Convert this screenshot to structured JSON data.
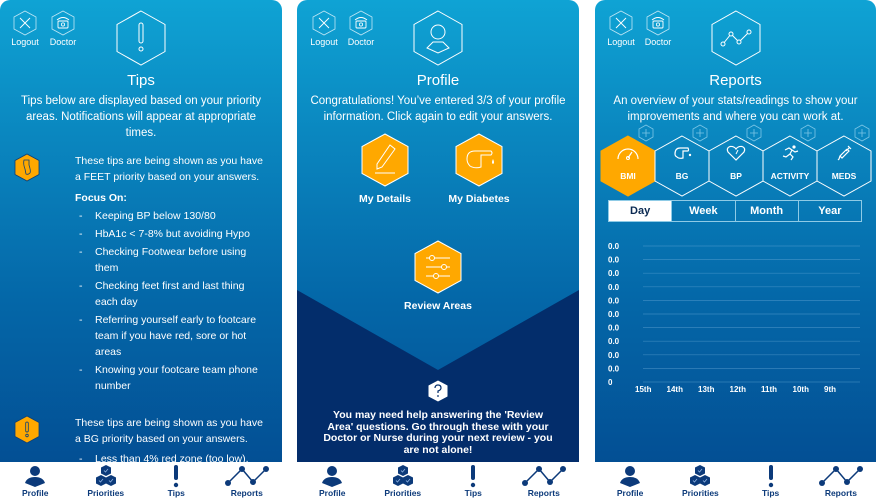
{
  "colors": {
    "accent": "#ffa800",
    "nav": "#0c3a7a",
    "panel_top": "#0fa3d4",
    "panel_bottom": "#034f94",
    "dark": "#032d6b"
  },
  "top_buttons": {
    "logout": "Logout",
    "doctor": "Doctor"
  },
  "nav": [
    {
      "label": "Profile",
      "icon": "person-icon"
    },
    {
      "label": "Priorities",
      "icon": "priorities-hex-icon"
    },
    {
      "label": "Tips",
      "icon": "exclamation-icon"
    },
    {
      "label": "Reports",
      "icon": "line-graph-icon"
    }
  ],
  "tips_screen": {
    "title": "Tips",
    "description": "Tips below are displayed based on your priority areas. Notifications will appear at appropriate times.",
    "blocks": [
      {
        "icon": "foot-icon",
        "intro": "These tips are being shown as you have a FEET priority based on your answers.",
        "focus_label": "Focus On:",
        "items": [
          "Keeping BP below 130/80",
          "HbA1c < 7-8% but avoiding Hypo",
          "Checking Footwear before using them",
          "Checking feet first and last thing each day",
          "Referring yourself early to footcare team if you have red, sore or hot areas",
          "Knowing your footcare team phone number"
        ]
      },
      {
        "icon": "exclamation-icon",
        "intro": "These tips are being shown as you have a BG priority based on your answers.",
        "items": [
          "Less than 4% red zone (too low),"
        ]
      }
    ]
  },
  "profile_screen": {
    "title": "Profile",
    "description": "Congratulations! You’ve entered 3/3 of your profile information. Click again to edit your answers.",
    "actions": [
      {
        "label": "My Details",
        "icon": "pencil-icon"
      },
      {
        "label": "My Diabetes",
        "icon": "finger-prick-icon"
      },
      {
        "label": "Review Areas",
        "icon": "sliders-icon"
      }
    ],
    "help_note": "You may need help answering the 'Review Area' questions. Go through these with your Doctor or Nurse during your next review - you are not alone!"
  },
  "reports_screen": {
    "title": "Reports",
    "description": "An overview of your stats/readings to show your improvements and where you can work at.",
    "metrics": [
      {
        "label": "BMI",
        "icon": "gauge-icon",
        "active": true
      },
      {
        "label": "BG",
        "icon": "finger-prick-icon",
        "active": false
      },
      {
        "label": "BP",
        "icon": "heart-icon",
        "active": false
      },
      {
        "label": "ACTIVITY",
        "icon": "runner-icon",
        "active": false
      },
      {
        "label": "MEDS",
        "icon": "syringe-icon",
        "active": false
      }
    ],
    "periods": [
      "Day",
      "Week",
      "Month",
      "Year"
    ],
    "active_period": "Day"
  },
  "chart_data": {
    "type": "line",
    "title": "",
    "xlabel": "",
    "ylabel": "",
    "categories": [
      "15th",
      "14th",
      "13th",
      "12th",
      "11th",
      "10th",
      "9th"
    ],
    "y_tick_labels": [
      "0.0",
      "0.0",
      "0.0",
      "0.0",
      "0.0",
      "0.0",
      "0.0",
      "0.0",
      "0.0",
      "0.0",
      "0"
    ],
    "series": [
      {
        "name": "BMI",
        "values": []
      }
    ],
    "ylim": [
      0,
      0
    ],
    "grid": true
  }
}
